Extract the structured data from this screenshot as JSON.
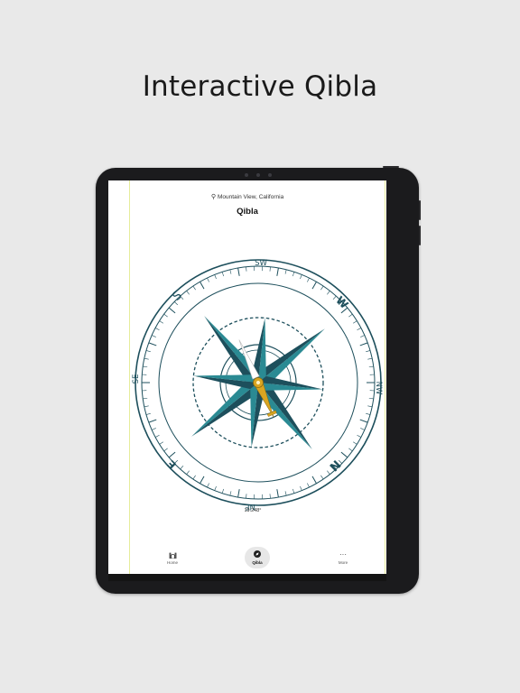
{
  "headline": "Interactive Qibla",
  "app": {
    "location": "Mountain View, California",
    "title": "Qibla",
    "directions": {
      "n": "N",
      "ne": "NE",
      "e": "E",
      "se": "SE",
      "s": "S",
      "sw": "SW",
      "w": "W",
      "nw": "NW"
    },
    "heading": "19.248°",
    "tabs": [
      {
        "label": "Home",
        "icon": "mosque-icon"
      },
      {
        "label": "Qibla",
        "icon": "compass-icon",
        "active": true
      },
      {
        "label": "More",
        "icon": "more-icon"
      }
    ]
  },
  "colors": {
    "compass_dark": "#1d4f5c",
    "compass_teal": "#2a8a93",
    "needle_gold": "#d9a521",
    "background": "#e9e9e9"
  }
}
